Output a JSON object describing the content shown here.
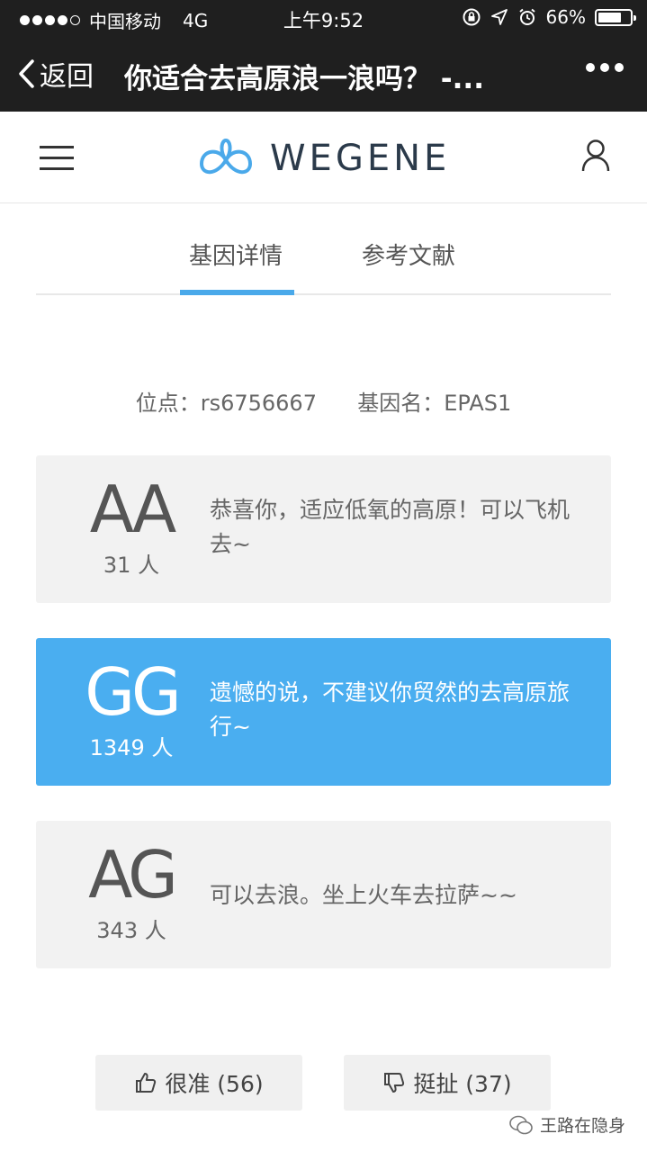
{
  "status_bar": {
    "carrier": "中国移动",
    "network": "4G",
    "time": "上午9:52",
    "battery": "66%"
  },
  "nav": {
    "back_label": "返回",
    "title": "你适合去高原浪一浪吗？ -..."
  },
  "header": {
    "brand": "WEGENE",
    "brand_color": "#4aa9ea"
  },
  "tabs": [
    {
      "label": "基因详情",
      "active": true
    },
    {
      "label": "参考文献",
      "active": false
    }
  ],
  "locus": {
    "site_label": "位点：",
    "site_value": "rs6756667",
    "gene_label": "基因名：",
    "gene_value": "EPAS1"
  },
  "genotypes": [
    {
      "genotype": "AA",
      "count": "31 人",
      "description": "恭喜你，适应低氧的高原！可以飞机去~",
      "active": false
    },
    {
      "genotype": "GG",
      "count": "1349 人",
      "description": "遗憾的说，不建议你贸然的去高原旅行~",
      "active": true
    },
    {
      "genotype": "AG",
      "count": "343 人",
      "description": "可以去浪。坐上火车去拉萨~~",
      "active": false
    }
  ],
  "votes": {
    "up_label": "很准 (56)",
    "down_label": "挺扯 (37)"
  },
  "watermark": "王路在隐身",
  "colors": {
    "accent": "#4aaef0",
    "topbar": "#1f1f1f",
    "card_bg": "#f2f2f2"
  }
}
